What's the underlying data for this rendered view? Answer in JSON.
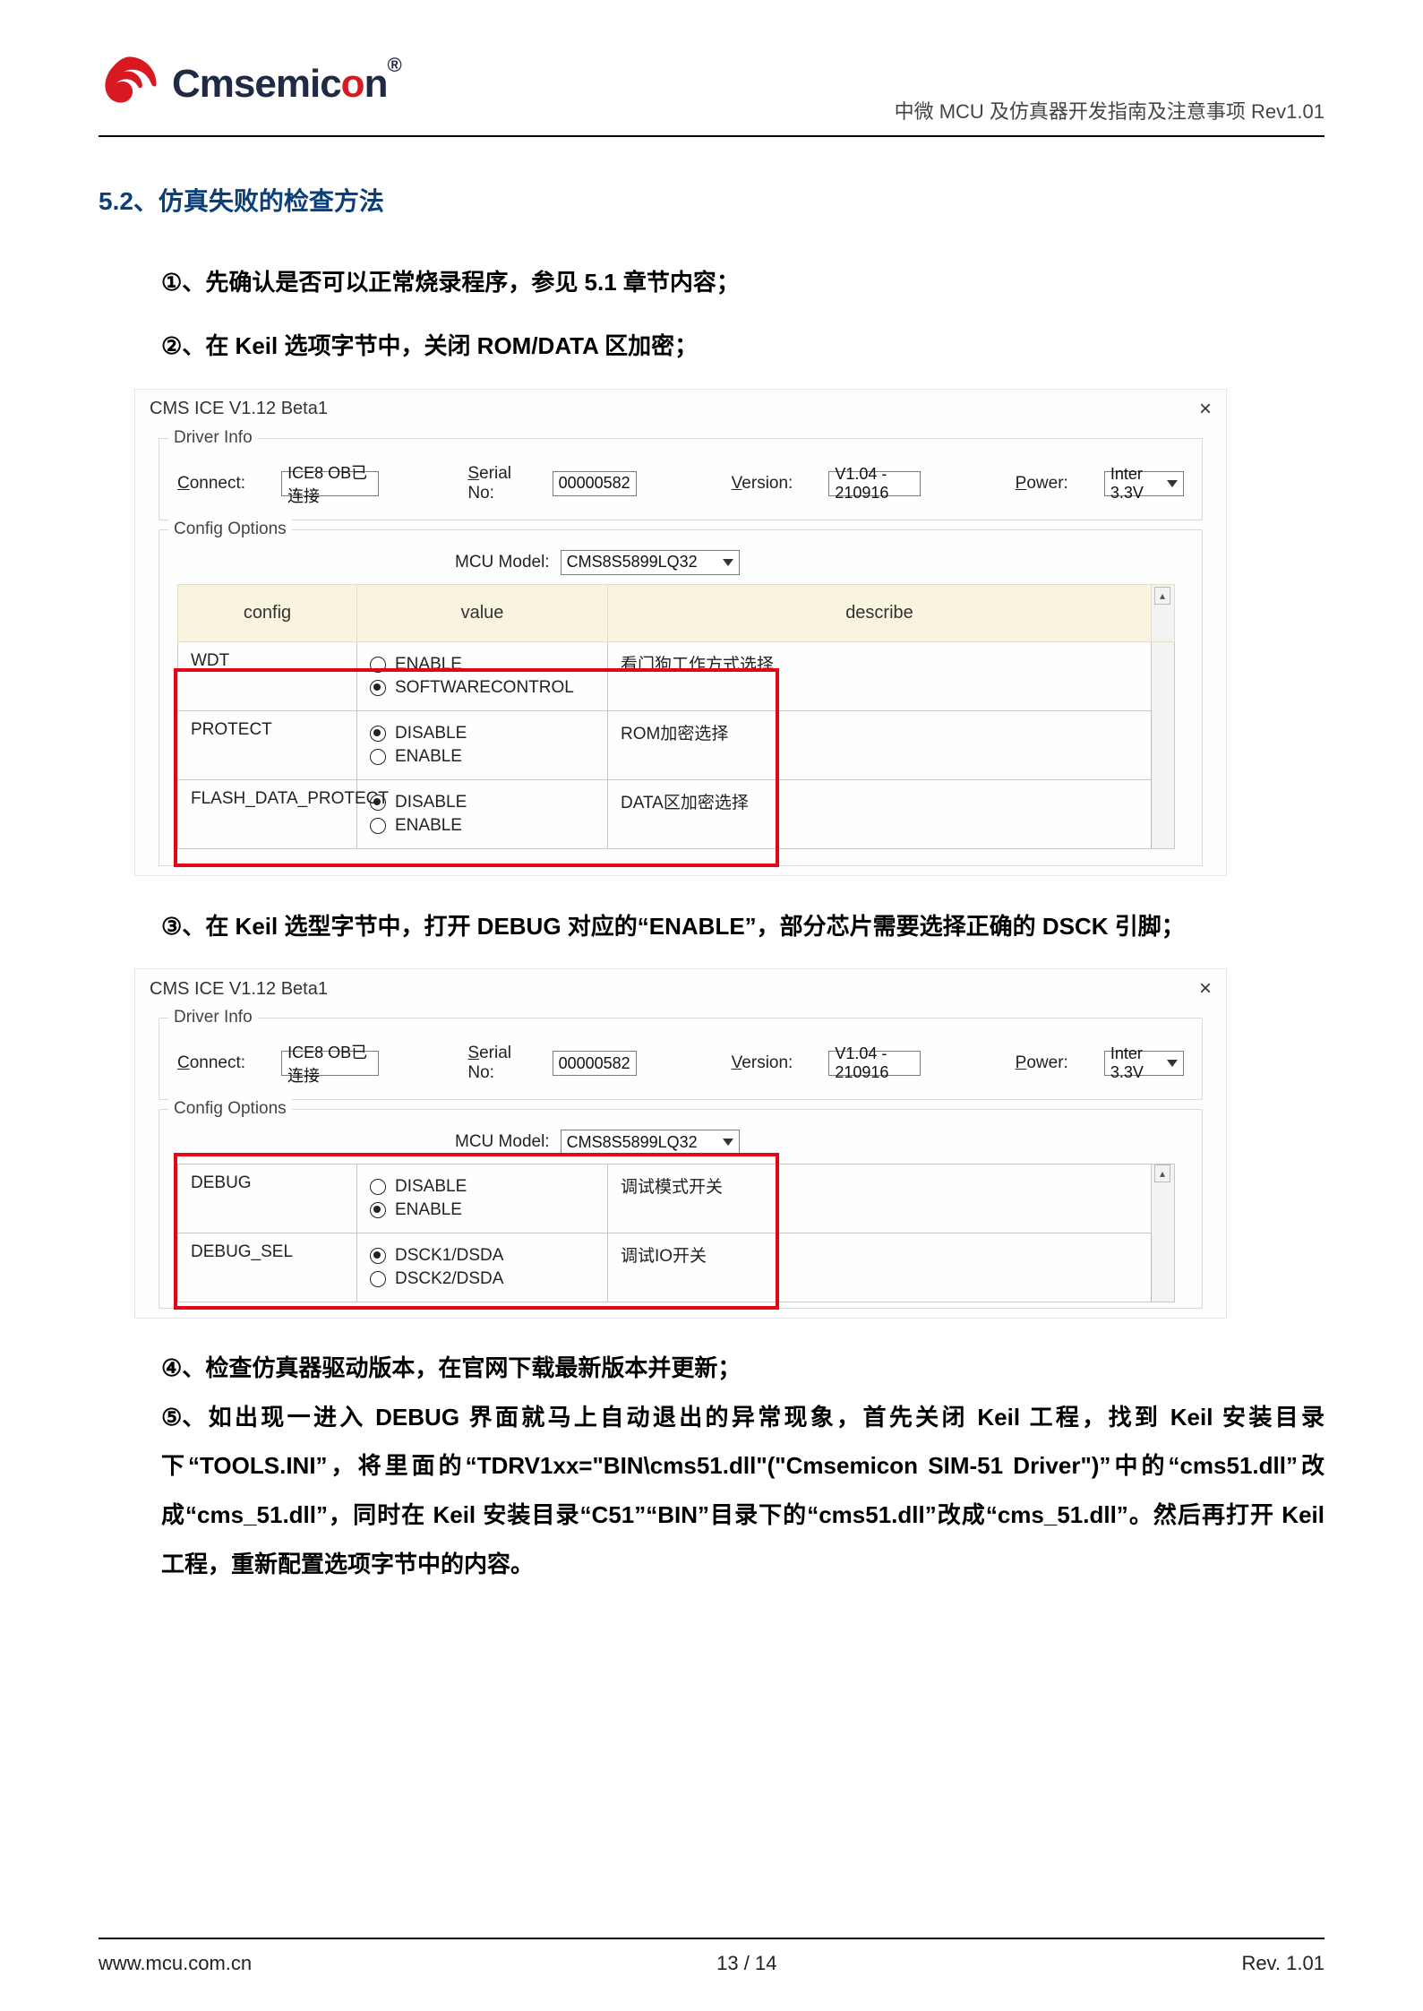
{
  "header": {
    "brand_text": "Cmsemic",
    "brand_dot": "o",
    "brand_text2": "n",
    "brand_reg": "®",
    "doc_title": "中微 MCU 及仿真器开发指南及注意事项  Rev1.01"
  },
  "section": {
    "heading": "5.2、仿真失败的检查方法"
  },
  "steps": {
    "s1_num": "①、",
    "s1": "先确认是否可以正常烧录程序，参见 5.1 章节内容；",
    "s2_num": "②、",
    "s2": "在 Keil 选项字节中，关闭 ROM/DATA 区加密；",
    "s3_num": "③、",
    "s3": "在 Keil 选型字节中，打开 DEBUG 对应的“ENABLE”，部分芯片需要选择正确的  DSCK 引脚；",
    "s4_num": "④、",
    "s4": "检查仿真器驱动版本，在官网下载最新版本并更新；",
    "s5_num": "⑤、",
    "s5": "如出现一进入 DEBUG 界面就马上自动退出的异常现象，首先关闭 Keil 工程，找到 Keil 安装目录下“TOOLS.INI”，将里面的“TDRV1xx=\"BIN\\cms51.dll\"(\"Cmsemicon SIM-51 Driver\")”中的“cms51.dll”改成“cms_51.dll”，同时在 Keil 安装目录“C51”“BIN”目录下的“cms51.dll”改成“cms_51.dll”。然后再打开 Keil 工程，重新配置选项字节中的内容。"
  },
  "dialog1": {
    "title": "CMS ICE V1.12 Beta1",
    "close": "×",
    "driver_legend": "Driver Info",
    "connect_label": "Connect:",
    "connect_value": "ICE8 OB已连接",
    "serial_label": "Serial No:",
    "serial_value": "00000582",
    "version_label": "Version:",
    "version_value": "V1.04 - 210916",
    "power_label": "Power:",
    "power_value": "Inter 3.3V",
    "config_legend": "Config Options",
    "mcu_label": "MCU Model:",
    "mcu_value": "CMS8S5899LQ32",
    "th_config": "config",
    "th_value": "value",
    "th_describe": "describe",
    "rows": [
      {
        "name": "WDT",
        "opts": [
          "ENABLE",
          "SOFTWARECONTROL"
        ],
        "sel": 1,
        "desc": "看门狗工作方式选择"
      },
      {
        "name": "PROTECT",
        "opts": [
          "DISABLE",
          "ENABLE"
        ],
        "sel": 0,
        "desc": "ROM加密选择"
      },
      {
        "name": "FLASH_DATA_PROTECT",
        "opts": [
          "DISABLE",
          "ENABLE"
        ],
        "sel": 0,
        "desc": "DATA区加密选择"
      }
    ],
    "scroll_up": "▴"
  },
  "dialog2": {
    "title": "CMS ICE V1.12 Beta1",
    "close": "×",
    "driver_legend": "Driver Info",
    "connect_label": "Connect:",
    "connect_value": "ICE8 OB已连接",
    "serial_label": "Serial No:",
    "serial_value": "00000582",
    "version_label": "Version:",
    "version_value": "V1.04 - 210916",
    "power_label": "Power:",
    "power_value": "Inter 3.3V",
    "config_legend": "Config Options",
    "mcu_label": "MCU Model:",
    "mcu_value": "CMS8S5899LQ32",
    "rows": [
      {
        "name": "DEBUG",
        "opts": [
          "DISABLE",
          "ENABLE"
        ],
        "sel": 1,
        "desc": "调试模式开关"
      },
      {
        "name": "DEBUG_SEL",
        "opts": [
          "DSCK1/DSDA",
          "DSCK2/DSDA"
        ],
        "sel": 0,
        "desc": "调试IO开关"
      }
    ],
    "scroll_up": "▴"
  },
  "footer": {
    "url": "www.mcu.com.cn",
    "page": "13  /  14",
    "rev": "Rev. 1.01"
  }
}
